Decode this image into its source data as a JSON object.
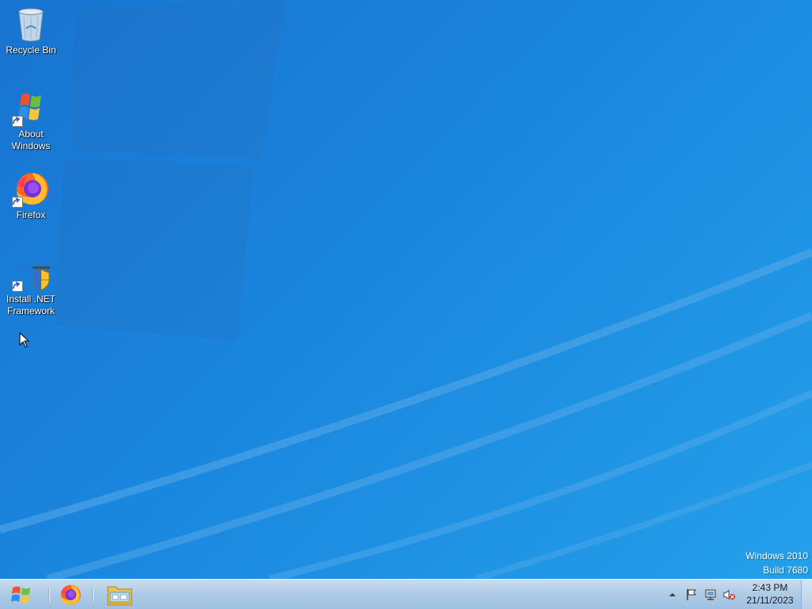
{
  "desktop": {
    "icons": [
      {
        "label": "Recycle Bin",
        "icon": "recycle-bin-icon",
        "shortcut": false
      },
      {
        "label": "About Windows",
        "icon": "windows-flag-icon",
        "shortcut": true
      },
      {
        "label": "Firefox",
        "icon": "firefox-icon",
        "shortcut": true
      },
      {
        "label": "Install .NET Framework",
        "icon": "dotnet-installer-icon",
        "shortcut": true
      }
    ],
    "watermark": {
      "line1": "Windows 2010",
      "line2": "Build 7680"
    },
    "background_color": "#1a86de"
  },
  "taskbar": {
    "start_icon": "windows-start-orb-icon",
    "pinned": [
      {
        "name": "Firefox",
        "icon": "firefox-icon"
      },
      {
        "name": "File Explorer",
        "icon": "folder-explorer-icon"
      }
    ],
    "tray": {
      "icons": [
        "show-hidden-icons-chevron-icon",
        "action-center-flag-icon",
        "network-icon",
        "volume-muted-icon"
      ],
      "time": "2:43 PM",
      "date": "21/11/2023"
    }
  }
}
